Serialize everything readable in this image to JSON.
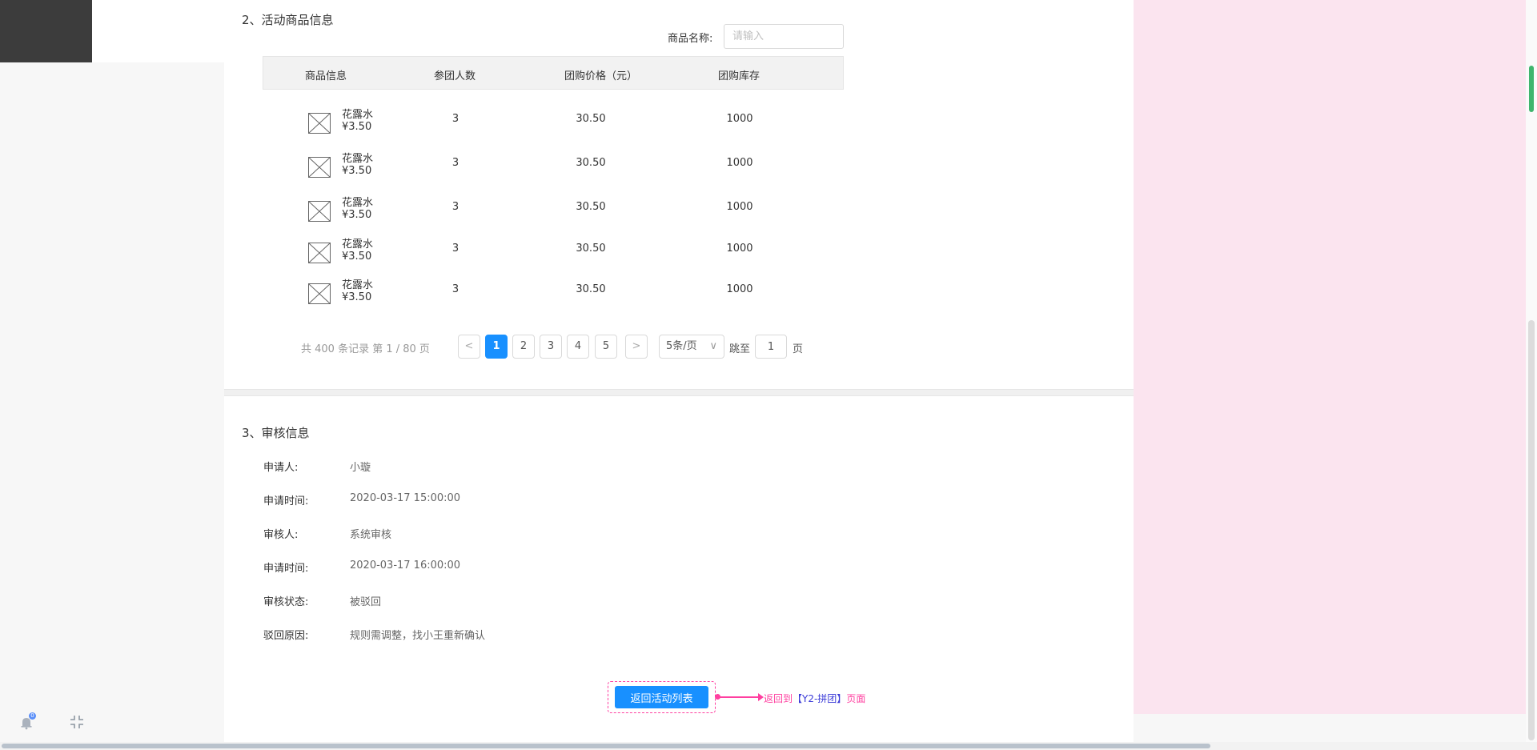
{
  "sections": {
    "products_title": "2、活动商品信息",
    "audit_title": "3、审核信息"
  },
  "search": {
    "label": "商品名称:",
    "placeholder": "请输入"
  },
  "table": {
    "headers": [
      "商品信息",
      "参团人数",
      "团购价格（元）",
      "团购库存"
    ],
    "rows": [
      {
        "name": "花露水",
        "price": "¥3.50",
        "members": "3",
        "group_price": "30.50",
        "stock": "1000"
      },
      {
        "name": "花露水",
        "price": "¥3.50",
        "members": "3",
        "group_price": "30.50",
        "stock": "1000"
      },
      {
        "name": "花露水",
        "price": "¥3.50",
        "members": "3",
        "group_price": "30.50",
        "stock": "1000"
      },
      {
        "name": "花露水",
        "price": "¥3.50",
        "members": "3",
        "group_price": "30.50",
        "stock": "1000"
      },
      {
        "name": "花露水",
        "price": "¥3.50",
        "members": "3",
        "group_price": "30.50",
        "stock": "1000"
      }
    ]
  },
  "pagination": {
    "total_text": "共 400 条记录 第 1 / 80 页",
    "prev": "<",
    "next": ">",
    "pages": [
      "1",
      "2",
      "3",
      "4",
      "5"
    ],
    "current": "1",
    "page_size": "5条/页",
    "page_size_chevron": "∨",
    "jump_label": "跳至",
    "jump_value": "1",
    "page_unit": "页"
  },
  "audit": {
    "applicant_label": "申请人:",
    "applicant_value": "小璇",
    "apply_time_label": "申请时间:",
    "apply_time_value": "2020-03-17 15:00:00",
    "reviewer_label": "审核人:",
    "reviewer_value": "系统审核",
    "review_time_label": "申请时间:",
    "review_time_value": "2020-03-17 16:00:00",
    "status_label": "审核状态:",
    "status_value": "被驳回",
    "reason_label": "驳回原因:",
    "reason_value": "规则需调整，找小王重新确认"
  },
  "actions": {
    "back_button": "返回活动列表",
    "annotation_prefix": "返回到",
    "annotation_target": "【Y2-拼团】",
    "annotation_suffix": "页面"
  },
  "colors": {
    "primary": "#1890ff",
    "annotation": "#ff3fa0",
    "annotation_link": "#3b3bd8",
    "side_panel": "#fbe4ef"
  },
  "notifications": {
    "badge": "0"
  }
}
